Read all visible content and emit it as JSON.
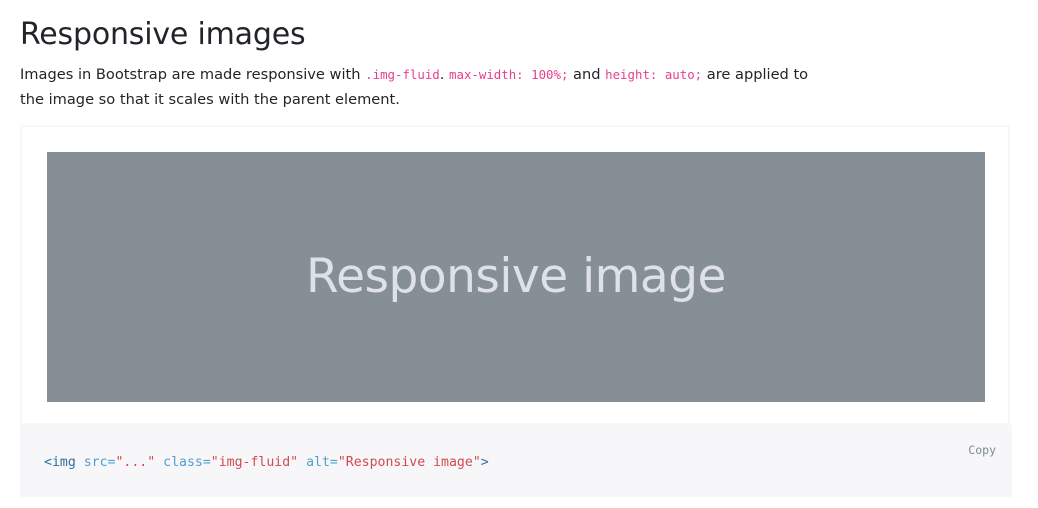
{
  "page": {
    "title": "Responsive images",
    "lead": {
      "t1": "Images in Bootstrap are made responsive with ",
      "code1": ".img-fluid",
      "t2": ". ",
      "code2": "max-width: 100%;",
      "t3": " and ",
      "code3": "height: auto;",
      "t4": " are applied to the image so that it scales with the parent element."
    }
  },
  "example": {
    "placeholder_text": "Responsive image",
    "placeholder_bg": "#868e96",
    "placeholder_fg": "#dee2e6"
  },
  "code": {
    "copy_label": "Copy",
    "tag_open": "<img",
    "space1": " ",
    "attr1": "src=",
    "val1": "\"...\"",
    "space2": " ",
    "attr2": "class=",
    "val2": "\"img-fluid\"",
    "space3": " ",
    "attr3": "alt=",
    "val3": "\"Responsive image\"",
    "tag_close": ">"
  }
}
